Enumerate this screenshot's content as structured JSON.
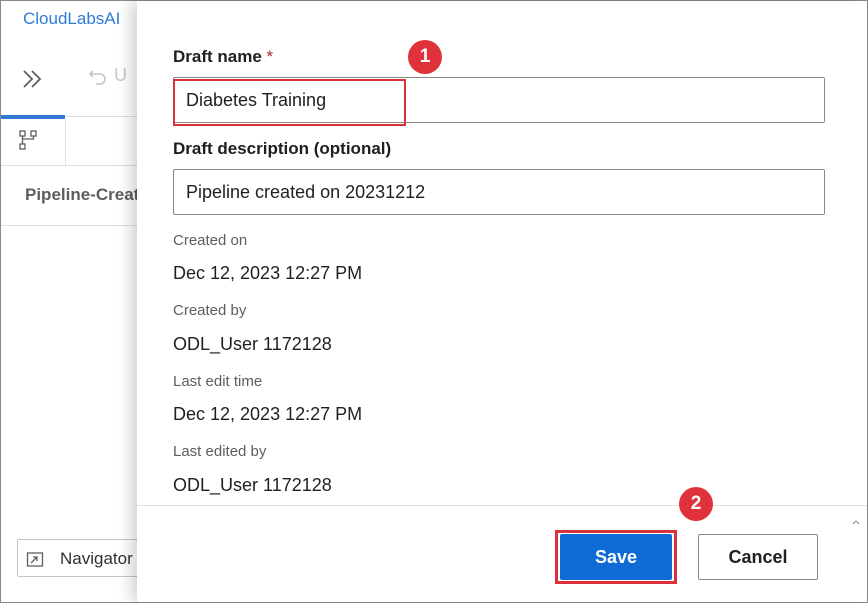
{
  "background_app": {
    "title": "CloudLabsAI",
    "undo_label": "U",
    "pipeline_title": "Pipeline-Created-on",
    "navigator_label": "Navigator"
  },
  "panel": {
    "draft_name": {
      "label": "Draft name",
      "required_mark": "*",
      "value": "Diabetes Training"
    },
    "draft_description": {
      "label": "Draft description (optional)",
      "value": "Pipeline created on 20231212"
    },
    "metadata": [
      {
        "label": "Created on",
        "value": "Dec 12, 2023 12:27 PM"
      },
      {
        "label": "Created by",
        "value": "ODL_User 1172128"
      },
      {
        "label": "Last edit time",
        "value": "Dec 12, 2023 12:27 PM"
      },
      {
        "label": "Last edited by",
        "value": "ODL_User 1172128"
      }
    ],
    "buttons": {
      "save": "Save",
      "cancel": "Cancel"
    }
  },
  "callouts": {
    "step1": "1",
    "step2": "2"
  },
  "colors": {
    "primary": "#0f6cd6",
    "callout": "#e0323a",
    "link": "#2f7bd6"
  },
  "icons": {
    "expand": "double-chevron-right-icon",
    "undo": "undo-icon",
    "pipeline_tab": "pipeline-graph-icon",
    "navigator": "navigator-icon"
  }
}
